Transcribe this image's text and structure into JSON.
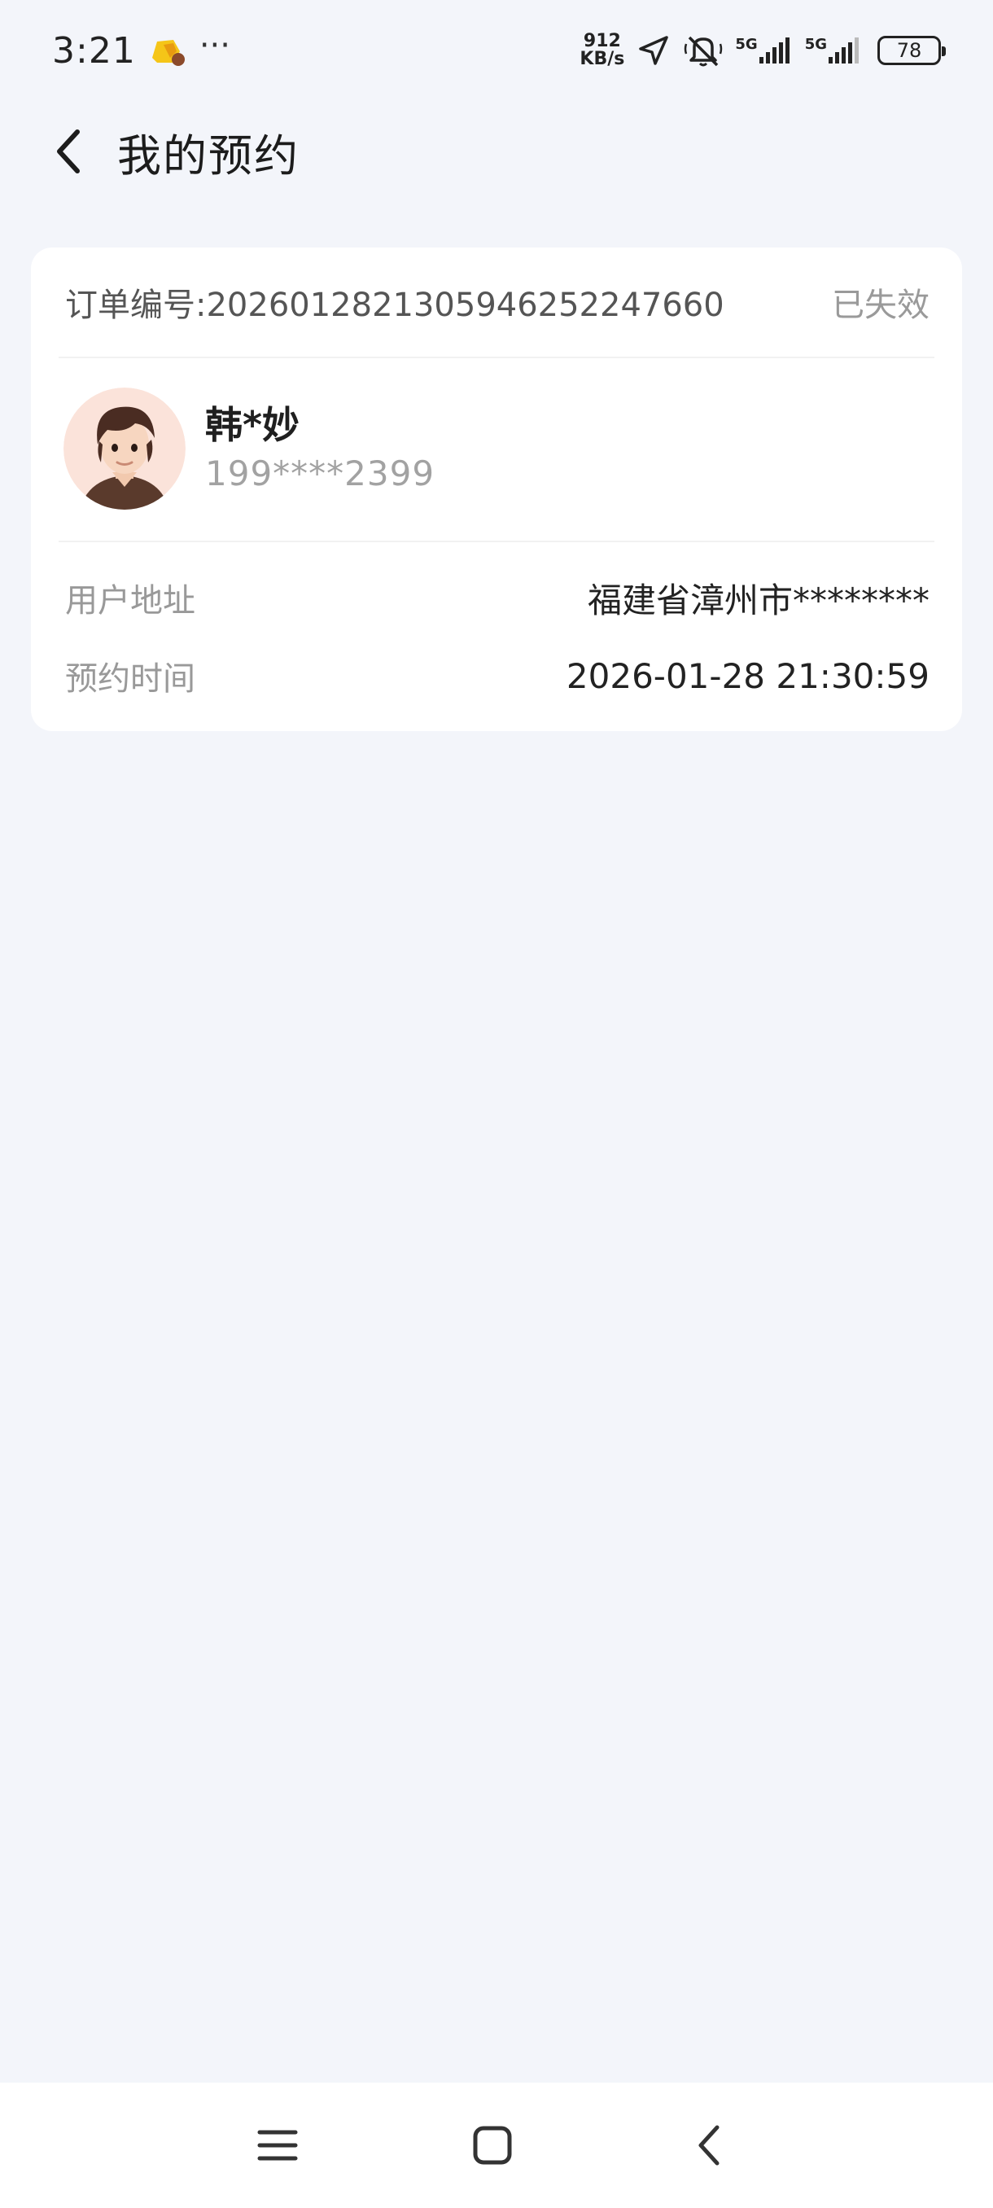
{
  "status_bar": {
    "time": "3:21",
    "more": "···",
    "net_speed_value": "912",
    "net_speed_unit": "KB/s",
    "signal1_label": "5G",
    "signal2_label": "5G",
    "battery": "78"
  },
  "header": {
    "title": "我的预约"
  },
  "order": {
    "number_label": "订单编号:2026012821305946252247660",
    "status": "已失效",
    "user_name": "韩*妙",
    "user_phone": "199****2399",
    "address_label": "用户地址",
    "address_value": "福建省漳州市********",
    "time_label": "预约时间",
    "time_value": "2026-01-28 21:30:59"
  },
  "icons": {
    "back": "chevron-left-icon",
    "menu": "menu-icon",
    "home": "home-icon",
    "nav_back": "nav-back-icon"
  }
}
